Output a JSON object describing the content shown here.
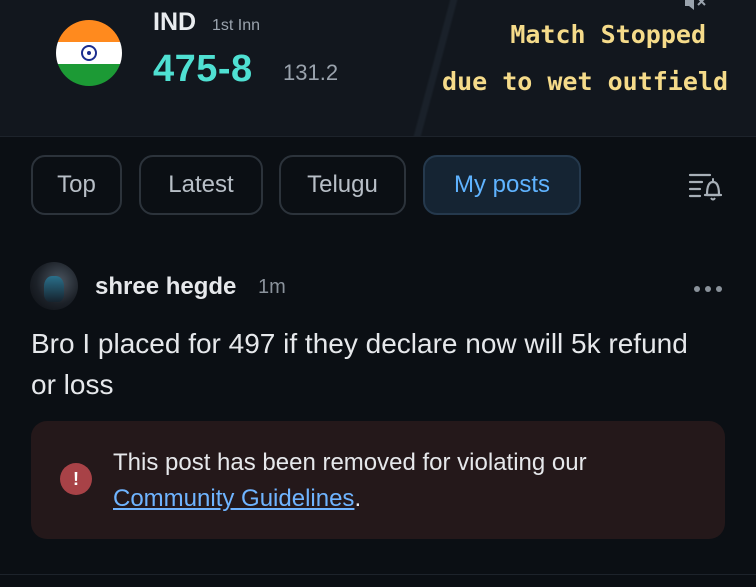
{
  "header": {
    "team": "IND",
    "innings": "1st Inn",
    "score": "475-8",
    "overs": "131.2",
    "status_line1": "Match Stopped",
    "status_line2": "due to wet outfield"
  },
  "tabs": [
    {
      "label": "Top",
      "active": false
    },
    {
      "label": "Latest",
      "active": false
    },
    {
      "label": "Telugu",
      "active": false
    },
    {
      "label": "My posts",
      "active": true
    }
  ],
  "post": {
    "author": "shree hegde",
    "time": "1m",
    "text": "Bro I placed for 497 if they declare now will 5k refund or loss",
    "removed_notice": "This post has been removed for violating our",
    "removed_link": "Community Guidelines",
    "removed_suffix": "."
  },
  "icons": {
    "flag": "india-flag-icon",
    "mute": "mute-icon",
    "filter": "notification-filter-icon",
    "more": "more-options-icon",
    "warning": "warning-icon"
  },
  "colors": {
    "score": "#4fe0d2",
    "status": "#f5db8a",
    "active_tab": "#5fb3ff",
    "link": "#6fb4ff",
    "removed_bg": "#24181a",
    "warning": "#a84247"
  }
}
